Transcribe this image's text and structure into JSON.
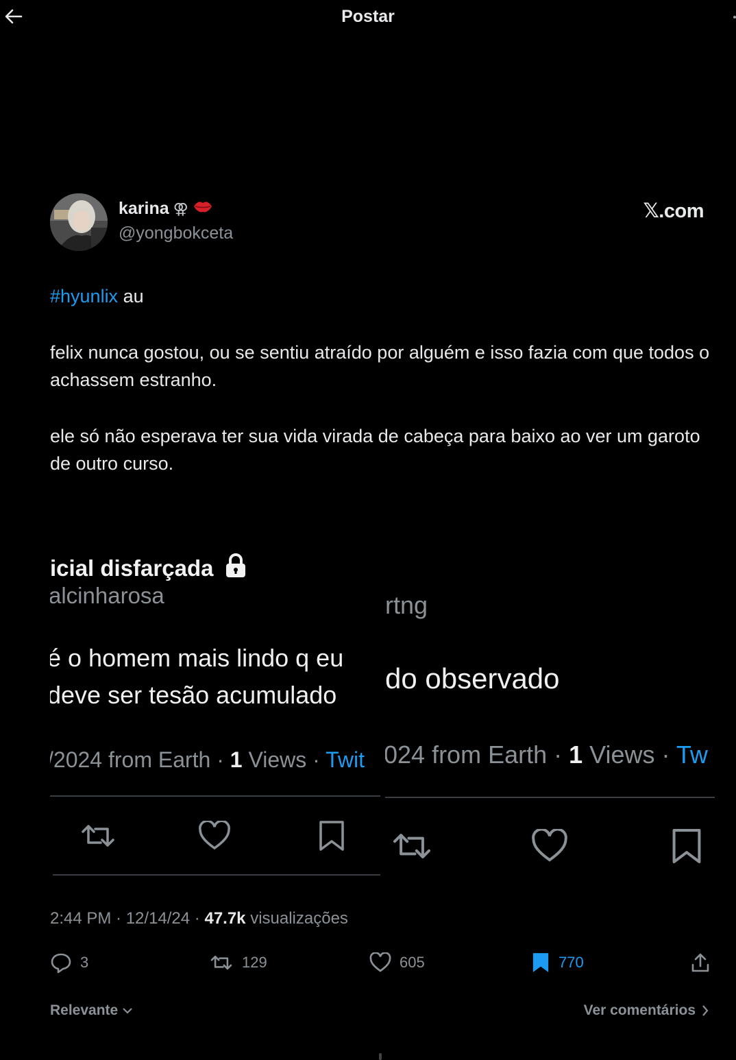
{
  "header": {
    "title": "Postar"
  },
  "author": {
    "display_name": "karina",
    "gender_symbol": "⚢",
    "emoji_icon": "lips-icon",
    "handle": "@yongbokceta",
    "watermark": "𝕏.com"
  },
  "tweet": {
    "hashtag": "#hyunlix",
    "line1_rest": " au",
    "paragraph2": "felix nunca gostou, ou se sentiu atraído por alguém e isso fazia com que todos o achassem estranho.",
    "paragraph3": "ele só não esperava ter sua vida virada de cabeça para baixo ao ver um garoto de outro curso."
  },
  "embedded_left": {
    "name": "icial disfarçada",
    "lock_icon": "lock-icon",
    "handle": "alcinharosa",
    "text_line1": "é o homem mais lindo q eu",
    "text_line2": "deve ser tesão acumulado",
    "meta_date": "/2024 from Earth · ",
    "meta_views_num": "1",
    "meta_views_label": " Views · ",
    "meta_link": "Twit"
  },
  "embedded_right": {
    "handle": "rtng",
    "text_line1": "do observado",
    "meta_date": "024 from Earth · ",
    "meta_views_num": "1",
    "meta_views_label": " Views · ",
    "meta_link": "Tw"
  },
  "meta": {
    "time": "2:44 PM · 12/14/24 · ",
    "views_count": "47.7k",
    "views_label": " visualizações"
  },
  "actions": {
    "replies": "3",
    "retweets": "129",
    "likes": "605",
    "bookmarks": "770"
  },
  "footer": {
    "sort_label": "Relevante",
    "see_comments": "Ver comentários"
  },
  "colors": {
    "accent": "#1d9bf0",
    "background": "#000000",
    "muted": "#8b9297",
    "lips": "#d8202a"
  }
}
